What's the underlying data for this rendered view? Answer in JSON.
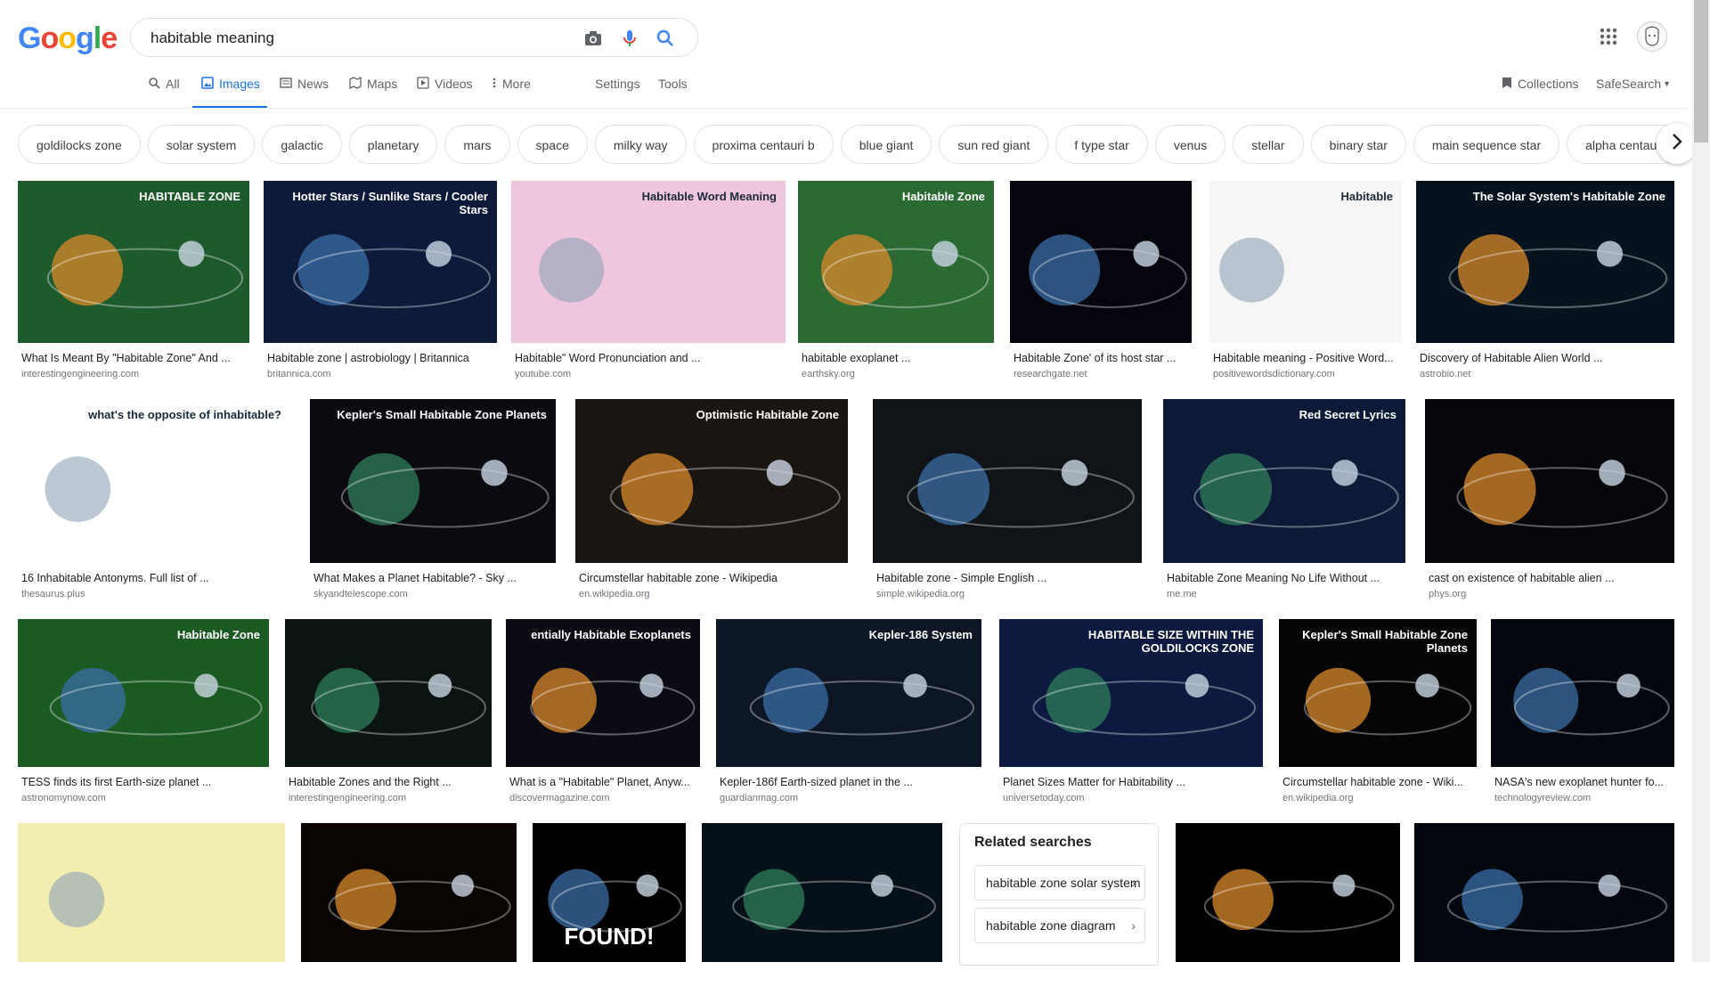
{
  "header": {
    "logo_letters": [
      "G",
      "o",
      "o",
      "g",
      "l",
      "e"
    ],
    "search_value": "habitable meaning"
  },
  "tabs": [
    {
      "label": "All",
      "icon": "search-icon"
    },
    {
      "label": "Images",
      "icon": "image-icon",
      "active": true
    },
    {
      "label": "News",
      "icon": "news-icon"
    },
    {
      "label": "Maps",
      "icon": "map-icon"
    },
    {
      "label": "Videos",
      "icon": "video-icon"
    },
    {
      "label": "More",
      "icon": "more-vert-icon"
    },
    {
      "label": "Settings"
    },
    {
      "label": "Tools"
    }
  ],
  "right_tools": {
    "collections": "Collections",
    "safesearch": "SafeSearch"
  },
  "chips": [
    "goldilocks zone",
    "solar system",
    "galactic",
    "planetary",
    "mars",
    "space",
    "milky way",
    "proxima centauri b",
    "blue giant",
    "sun red giant",
    "f type star",
    "venus",
    "stellar",
    "binary star",
    "main sequence star",
    "alpha centauri"
  ],
  "results": [
    {
      "title": "What Is Meant By \"Habitable Zone\" And ...",
      "source": "interestingengineering.com",
      "thumb_text": "HABITABLE ZONE",
      "bg": "#1e5a2c"
    },
    {
      "title": "Habitable zone | astrobiology | Britannica",
      "source": "britannica.com",
      "thumb_text": "Hotter Stars / Sunlike Stars / Cooler Stars",
      "bg": "#0d1a3a"
    },
    {
      "title": "Habitable\" Word Pronunciation and ...",
      "source": "youtube.com",
      "thumb_text": "Habitable Word Meaning",
      "bg": "#efc6dd"
    },
    {
      "title": "habitable exoplanet ...",
      "source": "earthsky.org",
      "thumb_text": "Habitable Zone",
      "bg": "#2c6a34"
    },
    {
      "title": "Habitable Zone' of its host star ...",
      "source": "researchgate.net",
      "thumb_text": "",
      "bg": "#05060d"
    },
    {
      "title": "Habitable meaning - Positive Word...",
      "source": "positivewordsdictionary.com",
      "thumb_text": "Habitable",
      "bg": "#f6f6f6"
    },
    {
      "title": "Discovery of Habitable Alien World ...",
      "source": "astrobio.net",
      "thumb_text": "The Solar System's Habitable Zone",
      "bg": "#06121e"
    },
    {
      "title": "16 Inhabitable Antonyms. Full list of ...",
      "source": "thesaurus.plus",
      "thumb_text": "what's the opposite of inhabitable?",
      "bg": "#ffffff"
    },
    {
      "title": "What Makes a Planet Habitable? - Sky ...",
      "source": "skyandtelescope.com",
      "thumb_text": "Kepler's Small Habitable Zone Planets",
      "bg": "#0a0a10"
    },
    {
      "title": "Circumstellar habitable zone - Wikipedia",
      "source": "en.wikipedia.org",
      "thumb_text": "Optimistic Habitable Zone",
      "bg": "#1b1512"
    },
    {
      "title": "Habitable zone - Simple English ...",
      "source": "simple.wikipedia.org",
      "thumb_text": "",
      "bg": "#101418"
    },
    {
      "title": "Habitable Zone Meaning No Life Without ...",
      "source": "me.me",
      "thumb_text": "Red Secret Lyrics",
      "bg": "#0c1a38"
    },
    {
      "title": "cast on existence of habitable alien ...",
      "source": "phys.org",
      "thumb_text": "",
      "bg": "#05070a"
    },
    {
      "title": "TESS finds its first Earth-size planet ...",
      "source": "astronomynow.com",
      "thumb_text": "Habitable Zone",
      "bg": "#1b5a22"
    },
    {
      "title": "Habitable Zones and the Right ...",
      "source": "interestingengineering.com",
      "thumb_text": "",
      "bg": "#0a1410"
    },
    {
      "title": "What is a \"Habitable\" Planet, Anyw...",
      "source": "discovermagazine.com",
      "thumb_text": "entially Habitable Exoplanets",
      "bg": "#0b0b14"
    },
    {
      "title": "Kepler-186f Earth-sized planet in the ...",
      "source": "guardianmag.com",
      "thumb_text": "Kepler-186 System",
      "bg": "#0c1624"
    },
    {
      "title": "Planet Sizes Matter for Habitability ...",
      "source": "universetoday.com",
      "thumb_text": "HABITABLE SIZE WITHIN THE GOLDILOCKS ZONE",
      "bg": "#0b1a3e"
    },
    {
      "title": "Circumstellar habitable zone - Wiki...",
      "source": "en.wikipedia.org",
      "thumb_text": "Kepler's Small Habitable Zone Planets",
      "bg": "#050505"
    },
    {
      "title": "NASA's new exoplanet hunter fo...",
      "source": "technologyreview.com",
      "thumb_text": "",
      "bg": "#04080e"
    },
    {
      "title": "",
      "source": "",
      "thumb_text": "",
      "bg": "#f1eeb0"
    },
    {
      "title": "",
      "source": "",
      "thumb_text": "",
      "bg": "#0a0503"
    },
    {
      "title": "",
      "source": "",
      "thumb_text": "FOUND!",
      "bg": "#000000"
    },
    {
      "title": "",
      "source": "",
      "thumb_text": "",
      "bg": "#061018"
    },
    {
      "title": "",
      "source": "",
      "thumb_text": "",
      "bg": "#000000"
    },
    {
      "title": "",
      "source": "",
      "thumb_text": "",
      "bg": "#03070e"
    }
  ],
  "related": {
    "heading": "Related searches",
    "items": [
      "habitable zone solar system",
      "habitable zone diagram"
    ]
  }
}
